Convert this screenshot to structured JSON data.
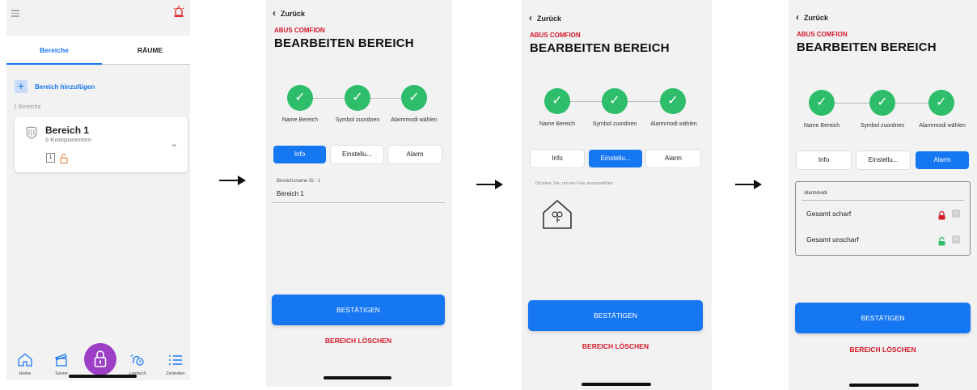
{
  "screen1": {
    "tabs": [
      "Bereiche",
      "RÄUME"
    ],
    "add_label": "Bereich hinzufügen",
    "count_label": "1 Bereiche",
    "area": {
      "title": "Bereich 1",
      "subtitle": "0 Komponenten",
      "component_count": "1"
    },
    "nav": [
      {
        "label": "Home",
        "icon": "home-icon"
      },
      {
        "label": "Szene",
        "icon": "scene-icon"
      },
      {
        "label": "Logbuch",
        "icon": "logbook-icon"
      },
      {
        "label": "Zentralen",
        "icon": "list-icon"
      }
    ],
    "fab_icon": "lock-icon"
  },
  "edit": {
    "back": "Zurück",
    "brand": "ABUS COMFION",
    "heading": "BEARBEITEN BEREICH",
    "steps": [
      "Name Bereich",
      "Symbol zuordnen",
      "Alarmmodi wählen"
    ],
    "tabs": [
      "Info",
      "Einstellu...",
      "Alarm"
    ],
    "confirm": "BESTÄTIGEN",
    "delete": "BEREICH LÖSCHEN"
  },
  "screen2": {
    "field_label": "Bereichsname ID : 1",
    "field_value": "Bereich 1",
    "active_tab": "Info"
  },
  "screen3": {
    "photo_hint": "Drücken Sie, um ein Foto auszuwählen",
    "active_tab": "Einstellu..."
  },
  "screen4": {
    "active_tab": "Alarm",
    "section": "Alarmmodi",
    "modes": [
      {
        "label": "Gesamt scharf",
        "lock": "locked",
        "lock_color": "#d3182a",
        "checked": true
      },
      {
        "label": "Gesamt unscharf",
        "lock": "unlocked",
        "lock_color": "#2ebd6b",
        "checked": true
      }
    ]
  },
  "colors": {
    "accent": "#1677f2",
    "brand_red": "#d3182a",
    "step_green": "#2ebd6b",
    "fab_purple": "#9c3ec6"
  }
}
